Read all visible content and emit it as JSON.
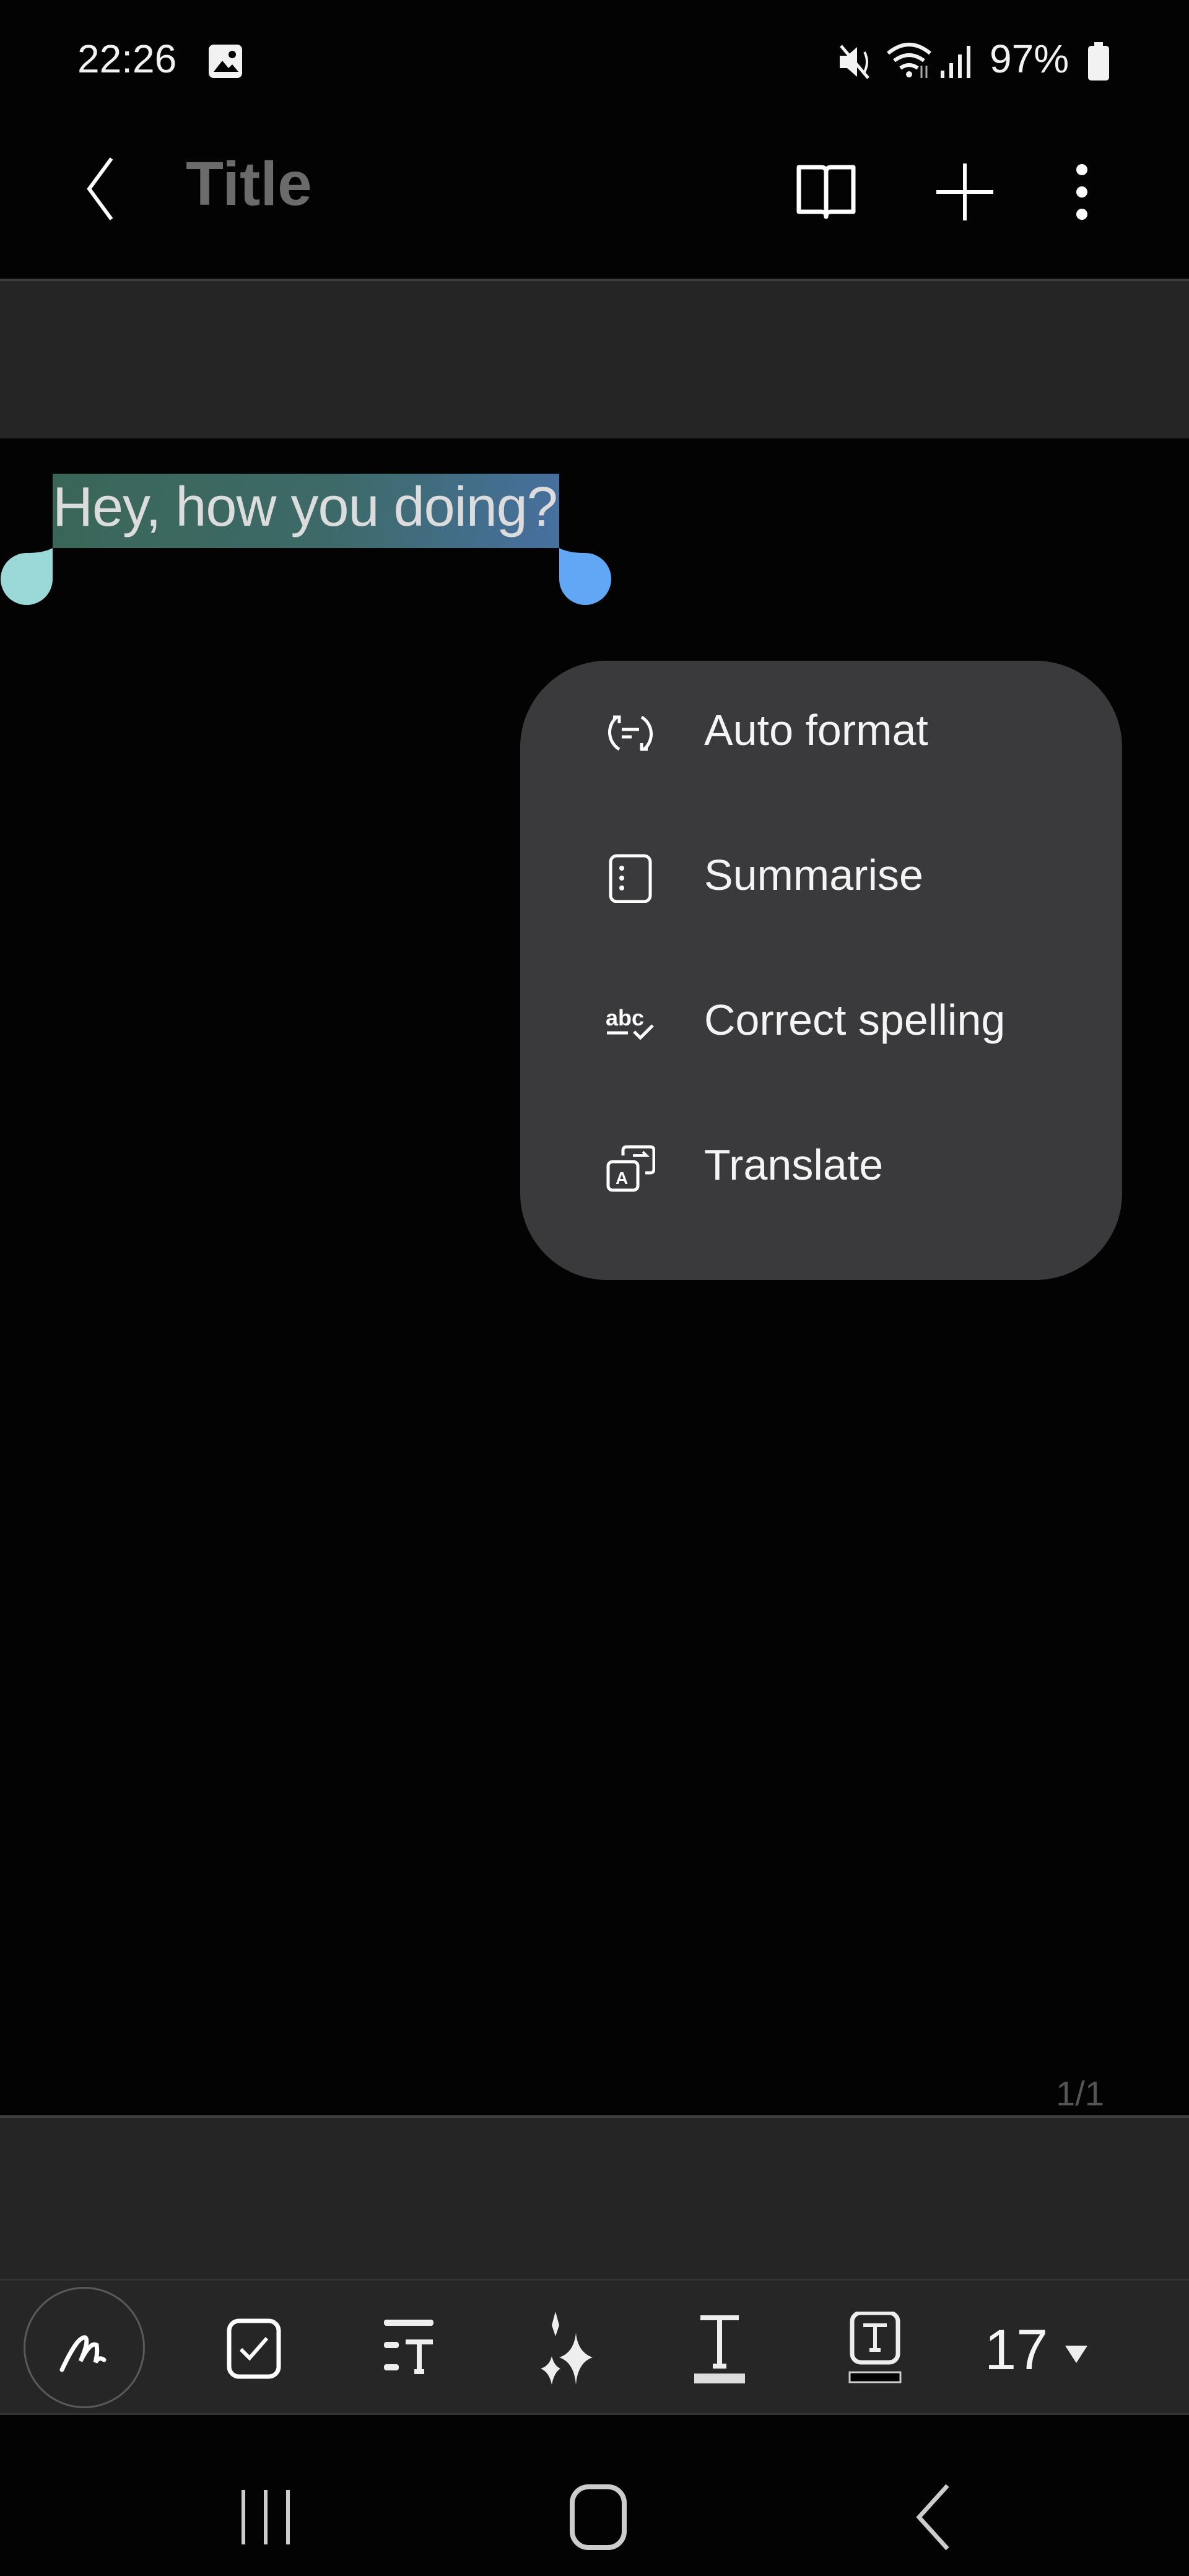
{
  "status_bar": {
    "time": "22:26",
    "battery": "97%",
    "icons": [
      "gallery-icon",
      "mute-icon",
      "wifi-icon",
      "signal-icon",
      "battery-icon"
    ]
  },
  "app_bar": {
    "title": "Title",
    "icons": [
      "back-icon",
      "reading-mode-icon",
      "add-icon",
      "more-options-icon"
    ]
  },
  "note": {
    "selected_text": "Hey, how you doing?",
    "page_indicator": "1/1"
  },
  "context_menu": {
    "items": [
      {
        "label": "Auto format",
        "icon": "auto-format-icon"
      },
      {
        "label": "Summarise",
        "icon": "summarise-icon"
      },
      {
        "label": "Correct spelling",
        "icon": "spell-check-icon"
      },
      {
        "label": "Translate",
        "icon": "translate-icon"
      }
    ]
  },
  "toolbar": {
    "icons": [
      "handwriting-icon",
      "checkbox-icon",
      "text-style-icon",
      "ai-sparkle-icon",
      "text-color-icon",
      "text-background-icon"
    ],
    "font_size": "17"
  },
  "nav_bar": {
    "icons": [
      "recent-apps-icon",
      "home-icon",
      "back-icon"
    ]
  },
  "colors": {
    "menu_bg": "#3a3a3c",
    "handle_left": "#9bd8d8",
    "handle_right": "#62a6f6",
    "title": "#6b6b6b"
  }
}
